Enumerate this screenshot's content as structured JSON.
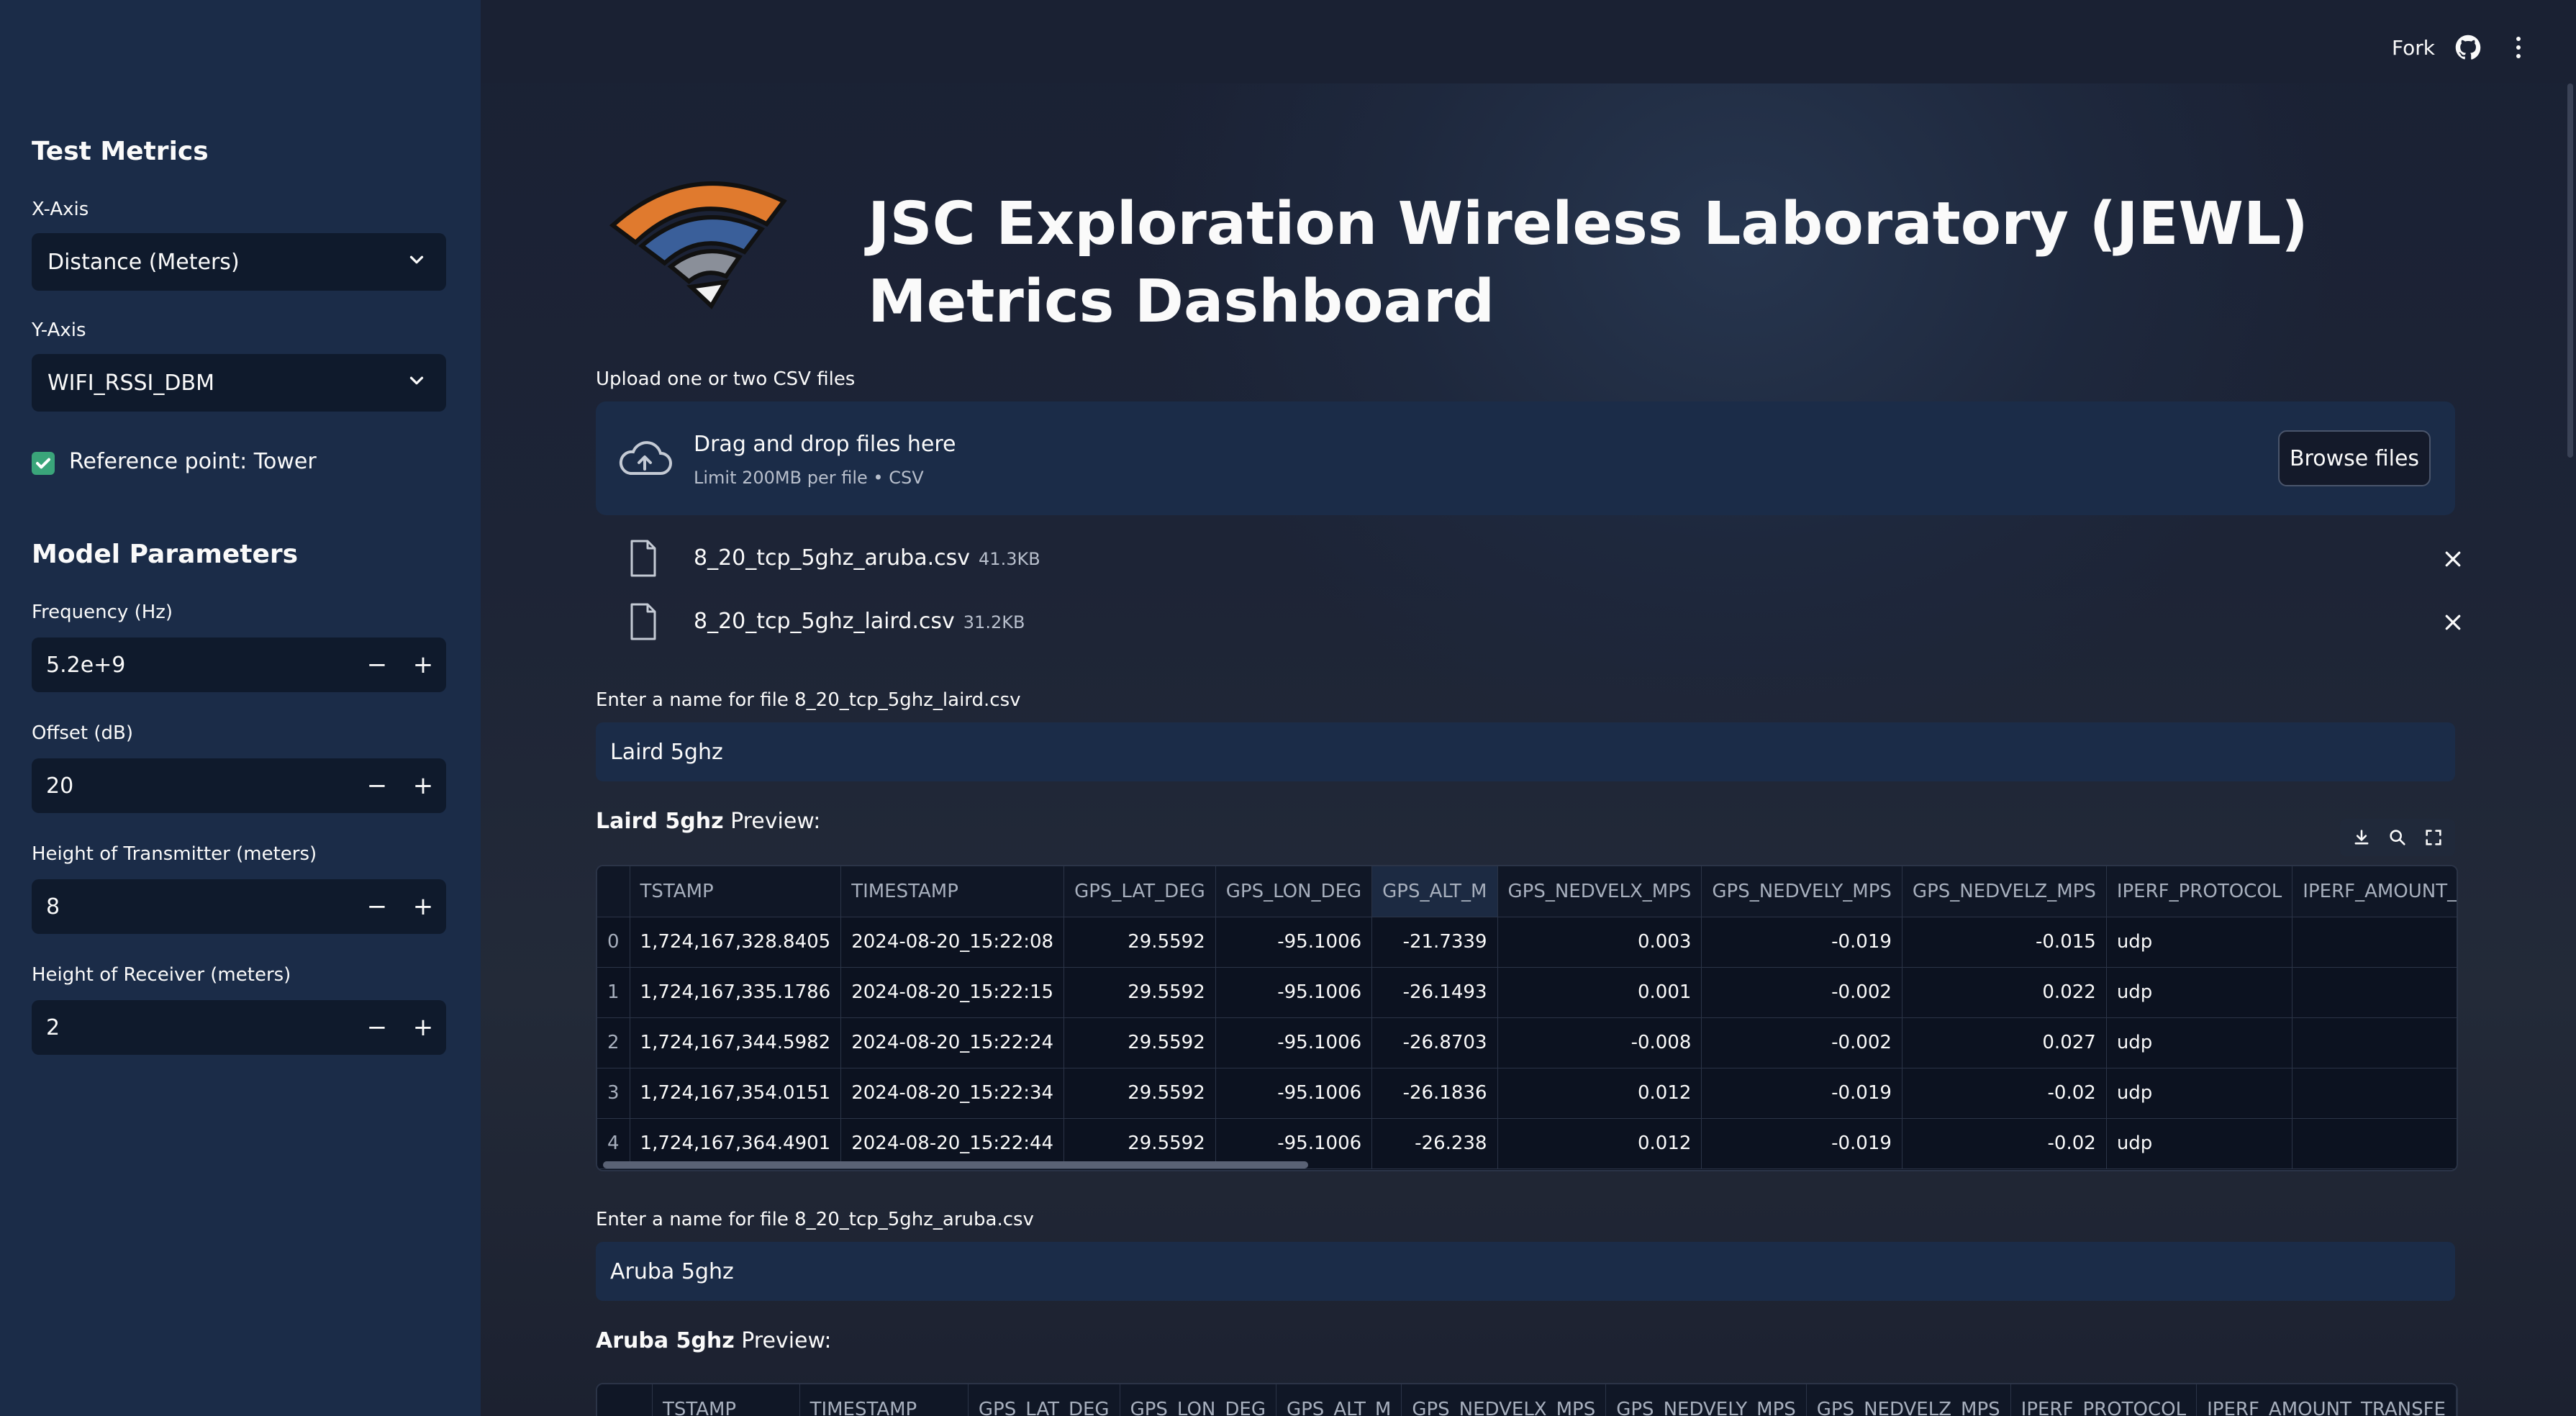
{
  "sidebar": {
    "test_metrics_heading": "Test Metrics",
    "x_axis_label": "X-Axis",
    "x_axis_value": "Distance (Meters)",
    "y_axis_label": "Y-Axis",
    "y_axis_value": "WIFI_RSSI_DBM",
    "reference_checkbox_label": "Reference point: Tower",
    "reference_checked": true,
    "model_params_heading": "Model Parameters",
    "frequency_label": "Frequency (Hz)",
    "frequency_value": "5.2e+9",
    "offset_label": "Offset (dB)",
    "offset_value": "20",
    "tx_height_label": "Height of Transmitter (meters)",
    "tx_height_value": "8",
    "rx_height_label": "Height of Receiver (meters)",
    "rx_height_value": "2",
    "minus": "−",
    "plus": "+"
  },
  "header": {
    "fork_label": "Fork",
    "icons": [
      "github-icon",
      "kebab-menu-icon"
    ]
  },
  "main": {
    "title": "JSC Exploration Wireless Laboratory (JEWL) Metrics Dashboard",
    "upload_label": "Upload one or two CSV files",
    "drop_title": "Drag and drop files here",
    "drop_sub": "Limit 200MB per file • CSV",
    "browse_label": "Browse files",
    "files": [
      {
        "name": "8_20_tcp_5ghz_aruba.csv",
        "size": "41.3KB"
      },
      {
        "name": "8_20_tcp_5ghz_laird.csv",
        "size": "31.2KB"
      }
    ],
    "laird_name_label": "Enter a name for file 8_20_tcp_5ghz_laird.csv",
    "laird_name_value": "Laird 5ghz",
    "laird_preview_name": "Laird 5ghz",
    "preview_suffix": " Preview:",
    "aruba_name_label": "Enter a name for file 8_20_tcp_5ghz_aruba.csv",
    "aruba_name_value": "Aruba 5ghz",
    "aruba_preview_name": "Aruba 5ghz"
  },
  "table": {
    "columns": [
      "",
      "TSTAMP",
      "TIMESTAMP",
      "GPS_LAT_DEG",
      "GPS_LON_DEG",
      "GPS_ALT_M",
      "GPS_NEDVELX_MPS",
      "GPS_NEDVELY_MPS",
      "GPS_NEDVELZ_MPS",
      "IPERF_PROTOCOL",
      "IPERF_AMOUNT_TRANSFE"
    ],
    "rows": [
      [
        "0",
        "1,724,167,328.8405",
        "2024-08-20_15:22:08",
        "29.5592",
        "-95.1006",
        "-21.7339",
        "0.003",
        "-0.019",
        "-0.015",
        "udp",
        ""
      ],
      [
        "1",
        "1,724,167,335.1786",
        "2024-08-20_15:22:15",
        "29.5592",
        "-95.1006",
        "-26.1493",
        "0.001",
        "-0.002",
        "0.022",
        "udp",
        ""
      ],
      [
        "2",
        "1,724,167,344.5982",
        "2024-08-20_15:22:24",
        "29.5592",
        "-95.1006",
        "-26.8703",
        "-0.008",
        "-0.002",
        "0.027",
        "udp",
        ""
      ],
      [
        "3",
        "1,724,167,354.0151",
        "2024-08-20_15:22:34",
        "29.5592",
        "-95.1006",
        "-26.1836",
        "0.012",
        "-0.019",
        "-0.02",
        "udp",
        ""
      ],
      [
        "4",
        "1,724,167,364.4901",
        "2024-08-20_15:22:44",
        "29.5592",
        "-95.1006",
        "-26.238",
        "0.012",
        "-0.019",
        "-0.02",
        "udp",
        ""
      ]
    ]
  },
  "colors": {
    "sidebar_bg": "#1b2c48",
    "input_bg": "#0f1a2c",
    "checkbox": "#3aa57a",
    "logo_orange": "#e07a2e"
  }
}
